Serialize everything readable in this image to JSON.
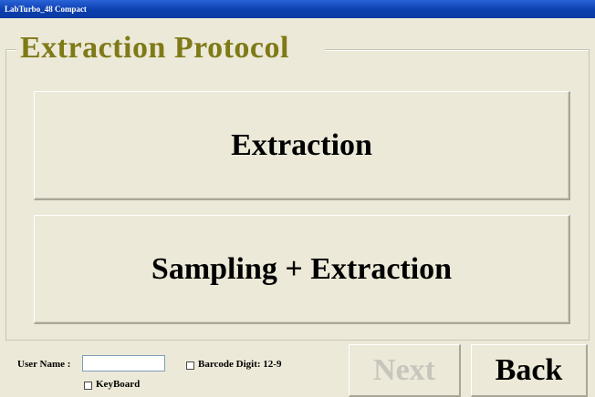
{
  "window": {
    "title": "LabTurbo_48 Compact"
  },
  "header": {
    "title": "Extraction Protocol"
  },
  "options": [
    {
      "label": "Extraction"
    },
    {
      "label": "Sampling + Extraction"
    }
  ],
  "footer": {
    "user_name_label": "User Name :",
    "user_name_value": "",
    "barcode_label": "Barcode Digit: 12-9",
    "keyboard_label": "KeyBoard",
    "next_label": "Next",
    "back_label": "Back"
  },
  "colors": {
    "background": "#ece9d8",
    "heading": "#7f7a18",
    "titlebar": "#0b3fae",
    "disabled_text": "#c7c5bd"
  }
}
